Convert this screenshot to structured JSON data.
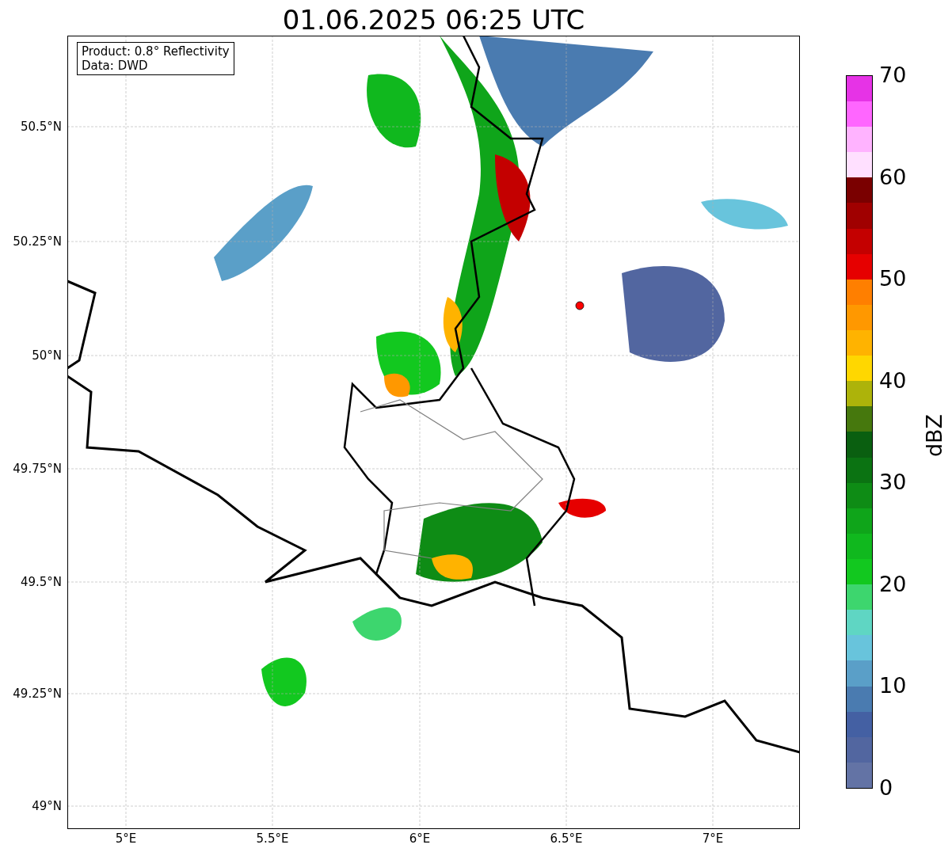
{
  "title": "01.06.2025 06:25 UTC",
  "info_box": [
    "Product: 0.8° Reflectivity",
    "Data: DWD"
  ],
  "map": {
    "lat_ticks": [
      "50.5°N",
      "50.25°N",
      "50°N",
      "49.75°N",
      "49.5°N",
      "49.25°N",
      "49°N"
    ],
    "lon_ticks": [
      "5°E",
      "5.5°E",
      "6°E",
      "6.5°E",
      "7°E"
    ]
  },
  "colorbar": {
    "label": "dBZ",
    "ticks": [
      "70",
      "60",
      "50",
      "40",
      "30",
      "20",
      "10",
      "0"
    ],
    "segments": [
      {
        "color": "#6373a5"
      },
      {
        "color": "#5266a0"
      },
      {
        "color": "#4460a3"
      },
      {
        "color": "#4a7bb0"
      },
      {
        "color": "#5a9fc8"
      },
      {
        "color": "#68c4dc"
      },
      {
        "color": "#5fd6c3"
      },
      {
        "color": "#3dd66e"
      },
      {
        "color": "#12c81f"
      },
      {
        "color": "#10b81e"
      },
      {
        "color": "#0fa51a"
      },
      {
        "color": "#0e8c15"
      },
      {
        "color": "#0b7312"
      },
      {
        "color": "#0a5f10"
      },
      {
        "color": "#46780d"
      },
      {
        "color": "#adb30a"
      },
      {
        "color": "#ffd700"
      },
      {
        "color": "#ffb300"
      },
      {
        "color": "#ff9800"
      },
      {
        "color": "#ff7f00"
      },
      {
        "color": "#e60000"
      },
      {
        "color": "#c40000"
      },
      {
        "color": "#a00000"
      },
      {
        "color": "#7a0000"
      },
      {
        "color": "#ffe0ff"
      },
      {
        "color": "#ffb3ff"
      },
      {
        "color": "#ff66ff"
      },
      {
        "color": "#e633e6"
      }
    ]
  }
}
